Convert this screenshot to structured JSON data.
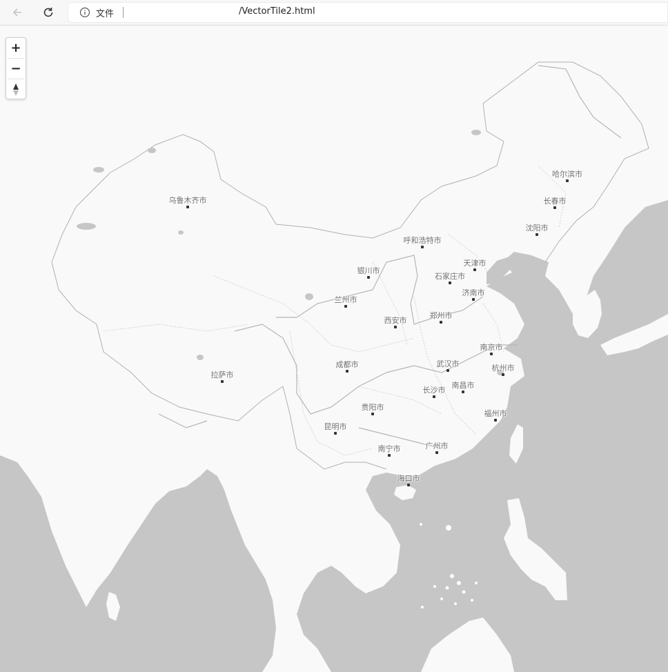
{
  "browser": {
    "file_label": "文件",
    "url": "/VectorTile2.html"
  },
  "zoom_control": {
    "zoom_in": "+",
    "zoom_out": "−"
  },
  "colors": {
    "land": "#f9f9f9",
    "sea": "#c6c6c6",
    "border": "#bdbdbd",
    "river": "#b5b5b5",
    "label": "#6f6f6f"
  },
  "cities": [
    {
      "name": "乌鲁木齐市"
    },
    {
      "name": "哈尔滨市"
    },
    {
      "name": "长春市"
    },
    {
      "name": "沈阳市"
    },
    {
      "name": "呼和浩特市"
    },
    {
      "name": "天津市"
    },
    {
      "name": "银川市"
    },
    {
      "name": "石家庄市"
    },
    {
      "name": "兰州市"
    },
    {
      "name": "济南市"
    },
    {
      "name": "西安市"
    },
    {
      "name": "郑州市"
    },
    {
      "name": "南京市"
    },
    {
      "name": "成都市"
    },
    {
      "name": "武汉市"
    },
    {
      "name": "杭州市"
    },
    {
      "name": "拉萨市"
    },
    {
      "name": "长沙市"
    },
    {
      "name": "南昌市"
    },
    {
      "name": "贵阳市"
    },
    {
      "name": "福州市"
    },
    {
      "name": "昆明市"
    },
    {
      "name": "南宁市"
    },
    {
      "name": "广州市"
    },
    {
      "name": "海口市"
    }
  ]
}
